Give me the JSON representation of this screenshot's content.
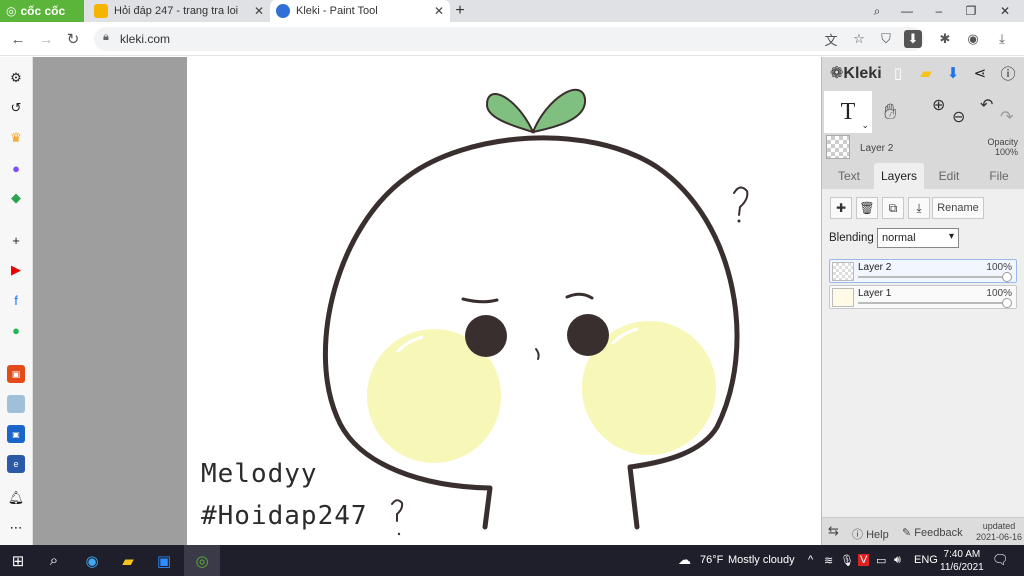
{
  "browser": {
    "coccoc_tab": "cốc cốc",
    "tabs": [
      {
        "title": "Hỏi đáp 247 - trang tra loi"
      },
      {
        "title": "Kleki - Paint Tool"
      }
    ],
    "url": "kleki.com"
  },
  "kleki": {
    "logo": "Kleki",
    "current_tool_glyph": "T",
    "layer_name": "Layer 2",
    "opacity_label": "Opacity",
    "opacity_value": "100%",
    "tabs": [
      "Text",
      "Layers",
      "Edit",
      "File"
    ],
    "active_tab": "Layers",
    "rename_label": "Rename",
    "blending_label": "Blending",
    "blending_value": "normal",
    "layers": [
      {
        "name": "Layer 2",
        "opacity": "100%",
        "selected": true
      },
      {
        "name": "Layer 1",
        "opacity": "100%",
        "selected": false
      }
    ],
    "footer": {
      "help": "Help",
      "feedback": "Feedback",
      "updated": "updated",
      "date": "2021-06-16"
    }
  },
  "canvas": {
    "text_line1": "Melodyy",
    "text_line2": "#Hoidap247",
    "colors": {
      "outline": "#3a2f2f",
      "leaf": "#7fbf7f",
      "cheek": "#f7f7b8"
    }
  },
  "taskbar": {
    "weather_temp": "76°F",
    "weather_text": "Mostly cloudy",
    "language": "ENG",
    "time": "7:40 AM",
    "date": "11/6/2021"
  }
}
